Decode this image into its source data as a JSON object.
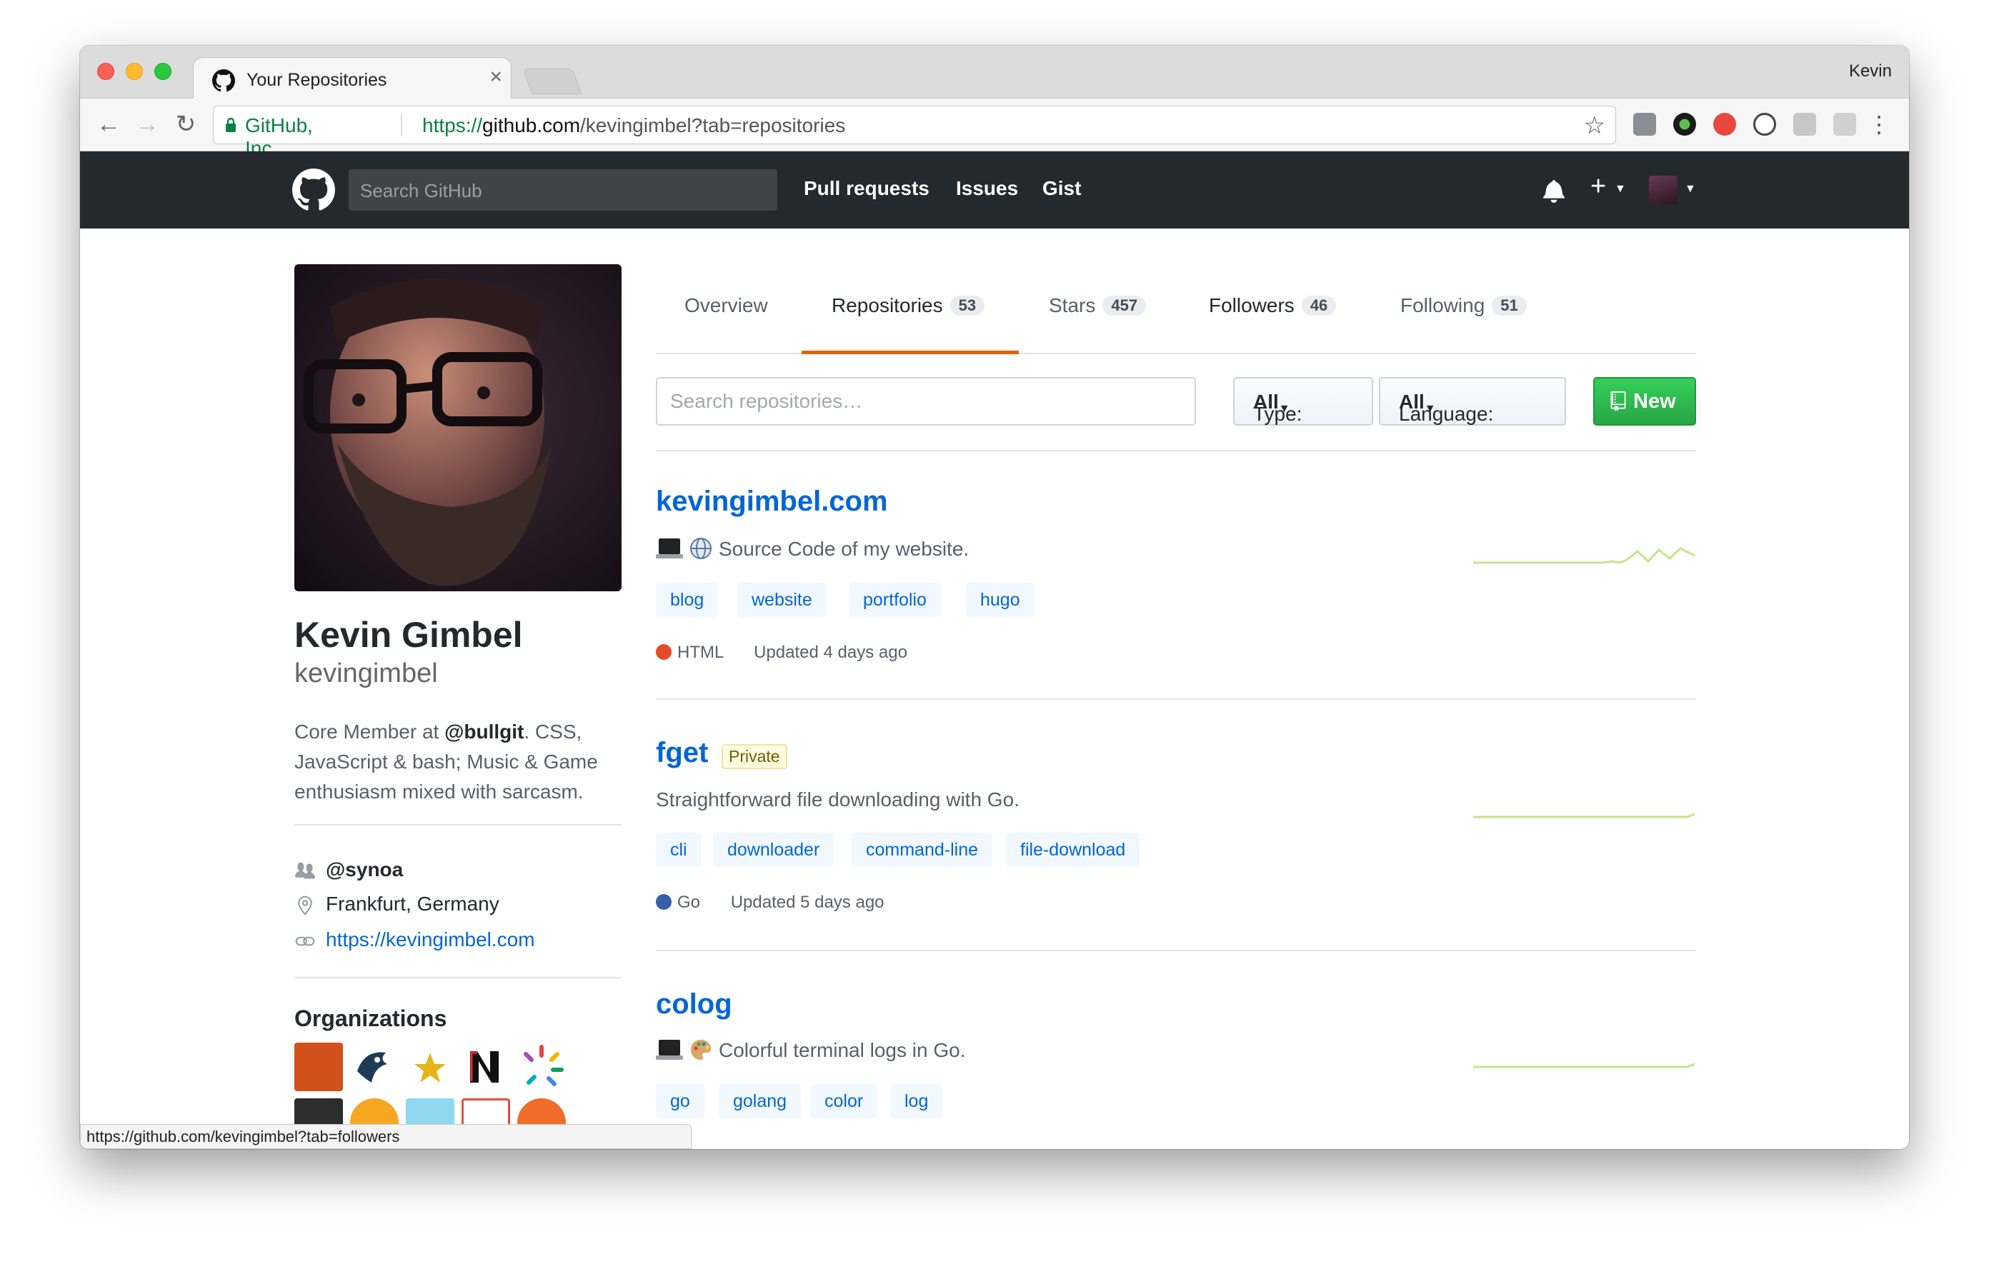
{
  "browser": {
    "tab_title": "Your Repositories",
    "tab_close": "×",
    "profile_name": "Kevin",
    "security_org": "GitHub, Inc. [US]",
    "url_scheme": "https://",
    "url_host": "github.com",
    "url_path": "/kevingimbel?tab=repositories",
    "status_url": "https://github.com/kevingimbel?tab=followers"
  },
  "header": {
    "search_placeholder": "Search GitHub",
    "nav": [
      "Pull requests",
      "Issues",
      "Gist"
    ],
    "plus": "+"
  },
  "profile": {
    "full_name": "Kevin Gimbel",
    "username": "kevingimbel",
    "bio_prefix": "Core Member at ",
    "bio_org": "@bullgit",
    "bio_rest": ". CSS,",
    "bio_line2": "JavaScript & bash; Music & Game",
    "bio_line3": "enthusiasm mixed with sarcasm.",
    "company": "@synoa",
    "location": "Frankfurt, Germany",
    "website": "https://kevingimbel.com",
    "organizations_title": "Organizations"
  },
  "tabs": [
    {
      "label": "Overview",
      "count": ""
    },
    {
      "label": "Repositories",
      "count": "53"
    },
    {
      "label": "Stars",
      "count": "457"
    },
    {
      "label": "Followers",
      "count": "46"
    },
    {
      "label": "Following",
      "count": "51"
    }
  ],
  "filters": {
    "search_placeholder": "Search repositories…",
    "type_label": "Type:",
    "type_value": "All",
    "language_label": "Language:",
    "language_value": "All",
    "new_label": "New"
  },
  "repos": [
    {
      "name": "kevingimbel.com",
      "description": "Source Code of my website.",
      "topics": [
        "blog",
        "website",
        "portfolio",
        "hugo"
      ],
      "language": "HTML",
      "language_color": "#e34c26",
      "updated": "Updated 4 days ago",
      "private": ""
    },
    {
      "name": "fget",
      "description": "Straightforward file downloading with Go.",
      "topics": [
        "cli",
        "downloader",
        "command-line",
        "file-download"
      ],
      "language": "Go",
      "language_color": "#375eab",
      "updated": "Updated 5 days ago",
      "private": "Private"
    },
    {
      "name": "colog",
      "description": "Colorful terminal logs in Go.",
      "topics": [
        "go",
        "golang",
        "color",
        "log"
      ],
      "language": "",
      "language_color": "",
      "updated": "",
      "private": ""
    }
  ],
  "colors": {
    "accent": "#e36209",
    "link": "#0366d6",
    "header_bg": "#24292e",
    "new_button": "#28a745",
    "sparkline": "#c6e48b"
  }
}
